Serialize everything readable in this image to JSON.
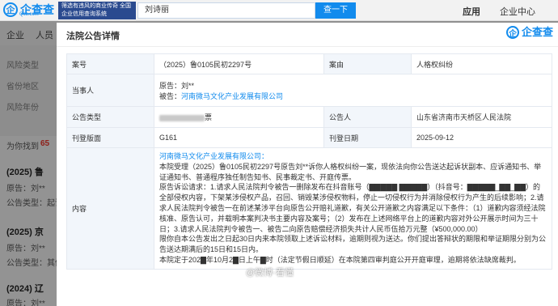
{
  "topbar": {
    "logo_mark": "企",
    "logo_text": "企查查",
    "logo_sub": "Qcc.com",
    "promo_text": "筛选有违风的商业传奇 全国企业信用查询系统",
    "search_value": "刘诗丽",
    "search_button": "查一下",
    "app_label": "应用",
    "center_label": "企业中心"
  },
  "nav": {
    "items": [
      "企业",
      "人员"
    ]
  },
  "filters": [
    "风险类型",
    "省份地区",
    "风险年份"
  ],
  "results": {
    "found_prefix": "为你找到",
    "found_count": "65",
    "cases": [
      {
        "title": "(2025) 鲁",
        "line1": "原告：刘**",
        "line2": "公告类型：起诉"
      },
      {
        "title": "(2025) 京",
        "line1": "原告：刘**",
        "line2": "公告类型：其他"
      },
      {
        "title": "(2024) 辽",
        "line1": "原告：刘**"
      }
    ]
  },
  "modal": {
    "title": "法院公告详情",
    "logo_text": "企查查",
    "rows": {
      "case_no_label": "案号",
      "case_no": "（2025）鲁0105民初2297号",
      "cause_label": "案由",
      "cause": "人格权纠纷",
      "party_label": "当事人",
      "plaintiff": "原告：刘**",
      "defendant_prefix": "被告：",
      "defendant": "河南微马文化产业发展有限公司",
      "type_label": "公告类型",
      "type_suffix": "票",
      "announcer_label": "公告人",
      "announcer": "山东省济南市天桥区人民法院",
      "page_label": "刊登版面",
      "page": "G161",
      "date_label": "刊登日期",
      "date": "2025-09-12",
      "content_label": "内容"
    },
    "content": {
      "addressee": "河南微马文化产业发展有限公司：",
      "p1": "本院受理（2025）鲁0105民初2297号原告刘**诉你人格权纠纷一案，现依法向你公告送达起诉状副本、应诉通知书、举证通知书、普通程序独任制告知书、民事裁定书、开庭传票。",
      "p2": "原告诉讼请求：1.请求人民法院判令被告一删除发布在抖音账号（▇▇▇▇▇ ▇▇▇▇▇）（抖音号：▇▇▇▇▇_▇▇_▇▇）的全部侵权内容，下架某涉侵权产品，召回、销毁某涉侵权物料，停止一切侵权行为并消除侵权行为产生的后续影响；2.请求人民法院判令被告一在前述某涉平台向原告公开赔礼道歉，有关公开道歉之内容满足以下条件：（1）道歉内容须经法院核准、原告认可，并载明本案判决书主要内容及案号；（2）发布在上述网络平台上的道歉内容对外公开展示时间为三十日；3.请求人民法院判令被告一、被告二向原告赔偿经济损失共计人民币伍拾万元整（¥500,000.00）",
      "p3": "限你自本公告发出之日起30日内来本院领取上述诉讼材料，逾期则视为送达。你们提出答辩状的期限和举证期限分别为公告送达期满后的15日和15日内。",
      "p4": "本院定于202▇年10月2▇日上午▇时（法定节假日顺延）在本院第四审判庭公开开庭审理，逾期将依法缺席裁判。"
    },
    "watermark": "@微博·看懂"
  }
}
